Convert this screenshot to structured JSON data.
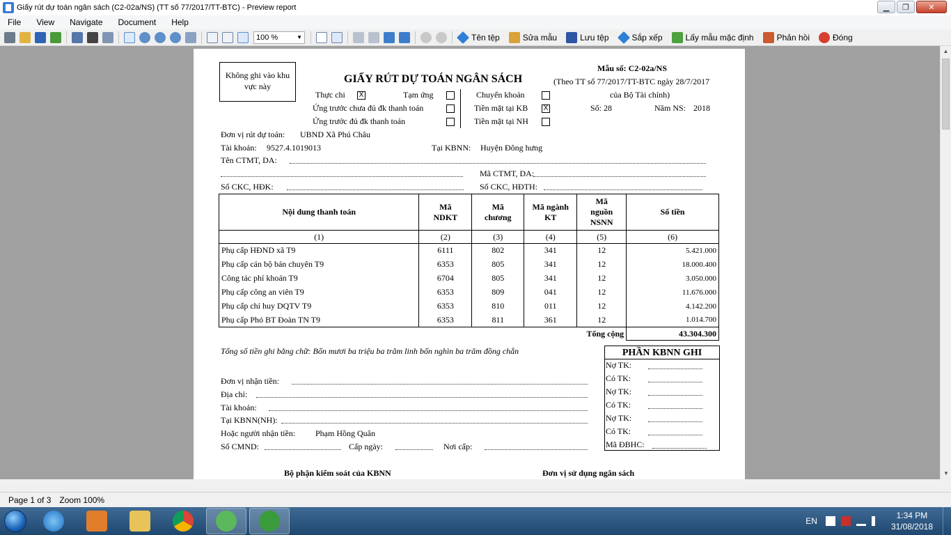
{
  "window": {
    "title": "Giấy rút dự toán ngân sách (C2-02a/NS) (TT số 77/2017/TT-BTC) - Preview report",
    "minimize": "▁",
    "maximize": "❐",
    "close": "✕"
  },
  "menu": [
    "File",
    "View",
    "Navigate",
    "Document",
    "Help"
  ],
  "toolbar": {
    "zoom": "100 %",
    "zoom_arrow": "▼",
    "buttons": {
      "open_file": "Tên tệp",
      "edit_template": "Sửa mẫu",
      "save_file": "Lưu tệp",
      "arrange": "Sắp xếp",
      "default_template": "Lấy mẫu mặc định",
      "feedback": "Phản hồi",
      "close": "Đóng"
    },
    "icons": [
      "printer-icon",
      "open-icon",
      "save-icon",
      "export-icon",
      "table-icon",
      "find-icon",
      "search-icon",
      "hand-icon",
      "zoom-icon",
      "zoom-in-icon",
      "zoom-out-icon",
      "zoom-area-icon",
      "page-width-icon",
      "fit-page-icon",
      "actual-size-icon"
    ]
  },
  "report": {
    "note_box": "Không ghi vào khu vực này",
    "title": "GIẤY RÚT DỰ TOÁN NGÂN SÁCH",
    "form_no": "Mẫu số: C2-02a/NS",
    "legal_line1": "(Theo TT số 77/2017/TT-BTC ngày 28/7/2017",
    "legal_line2": "của Bộ Tài chính)",
    "so_label": "Số: 28",
    "nam_ns_label": "Năm NS:",
    "nam_ns_value": "2018",
    "options": {
      "thuc_chi": "Thực chi",
      "tam_ung": "Tạm ứng",
      "chuyen_khoan": "Chuyển khoản",
      "ung_truoc_chua_du": "Ứng trước chưa đủ đk thanh toán",
      "tien_mat_kb": "Tiền mặt tại KB",
      "ung_truoc_du": "Ứng trước đủ đk thanh toán",
      "tien_mat_nh": "Tiền mặt tại NH",
      "check_mark": "X"
    },
    "don_vi_label": "Đơn vị rút dự toán:",
    "don_vi_value": "UBND Xã Phú Châu",
    "tai_khoan_label": "Tài khoản:",
    "tai_khoan_value": "9527.4.1019013",
    "tai_kbnn_label": "Tại KBNN:",
    "tai_kbnn_value": "Huyện Đông hưng",
    "ten_ctmt_label": "Tên CTMT, DA:",
    "ma_ctmt_label": "Mã CTMT, DA:",
    "so_ckc_hdk_label": "Số CKC, HĐK:",
    "so_ckc_hdth_label": "Số CKC, HĐTH:",
    "table": {
      "headers": [
        "Nội dung thanh toán",
        "Mã NDKT",
        "Mã chương",
        "Mã ngành KT",
        "Mã nguồn NSNN",
        "Số tiền"
      ],
      "col_numbers": [
        "(1)",
        "(2)",
        "(3)",
        "(4)",
        "(5)",
        "(6)"
      ],
      "rows": [
        {
          "noi_dung": "Phụ cấp HĐND xã T9",
          "ndkt": "6111",
          "chuong": "802",
          "nganh": "341",
          "nguon": "12",
          "so_tien": "5.421.000"
        },
        {
          "noi_dung": "Phụ cấp cán bộ bán chuyên T9",
          "ndkt": "6353",
          "chuong": "805",
          "nganh": "341",
          "nguon": "12",
          "so_tien": "18.000.400"
        },
        {
          "noi_dung": "Công tác phí khoán T9",
          "ndkt": "6704",
          "chuong": "805",
          "nganh": "341",
          "nguon": "12",
          "so_tien": "3.050.000"
        },
        {
          "noi_dung": "Phụ cấp công an viên T9",
          "ndkt": "6353",
          "chuong": "809",
          "nganh": "041",
          "nguon": "12",
          "so_tien": "11.676.000"
        },
        {
          "noi_dung": "Phụ cấp chỉ huy DQTV T9",
          "ndkt": "6353",
          "chuong": "810",
          "nganh": "011",
          "nguon": "12",
          "so_tien": "4.142.200"
        },
        {
          "noi_dung": "Phụ cấp Phó BT Đoàn TN T9",
          "ndkt": "6353",
          "chuong": "811",
          "nganh": "361",
          "nguon": "12",
          "so_tien": "1.014.700"
        }
      ],
      "total_label": "Tổng cộng",
      "total_value": "43.304.300"
    },
    "amount_in_words": "Tổng số tiền ghi bằng chữ: Bốn mươi ba triệu ba trăm linh bốn nghìn ba trăm đồng chẵn",
    "recipient": {
      "don_vi_nhan": "Đơn vị nhận tiền:",
      "dia_chi": "Địa chỉ:",
      "tai_khoan": "Tài khoản:",
      "tai_kbnn": "Tại KBNN(NH):",
      "nguoi_nhan_label": "Hoặc người nhận tiền:",
      "nguoi_nhan_value": "Phạm Hồng Quân",
      "so_cmnd": "Số CMND:",
      "cap_ngay": "Cấp ngày:",
      "noi_cap": "Nơi cấp:"
    },
    "kbnn_box": {
      "title": "PHẦN KBNN GHI",
      "lines": [
        "Nợ TK:",
        "Có TK:",
        "Nợ TK:",
        "Có TK:",
        "Nợ TK:",
        "Có TK:",
        "Mã ĐBHC:"
      ]
    },
    "bottom_left": "Bộ phận kiểm soát của KBNN",
    "bottom_right": "Đơn vị sử dụng ngân sách"
  },
  "status": {
    "page": "Page 1 of 3",
    "zoom": "Zoom 100%"
  },
  "taskbar": {
    "lang": "EN",
    "time": "1:34 PM",
    "date": "31/08/2018"
  },
  "colors": {
    "preview_bg": "#a0a0a0",
    "taskbar": "#2b5580"
  }
}
